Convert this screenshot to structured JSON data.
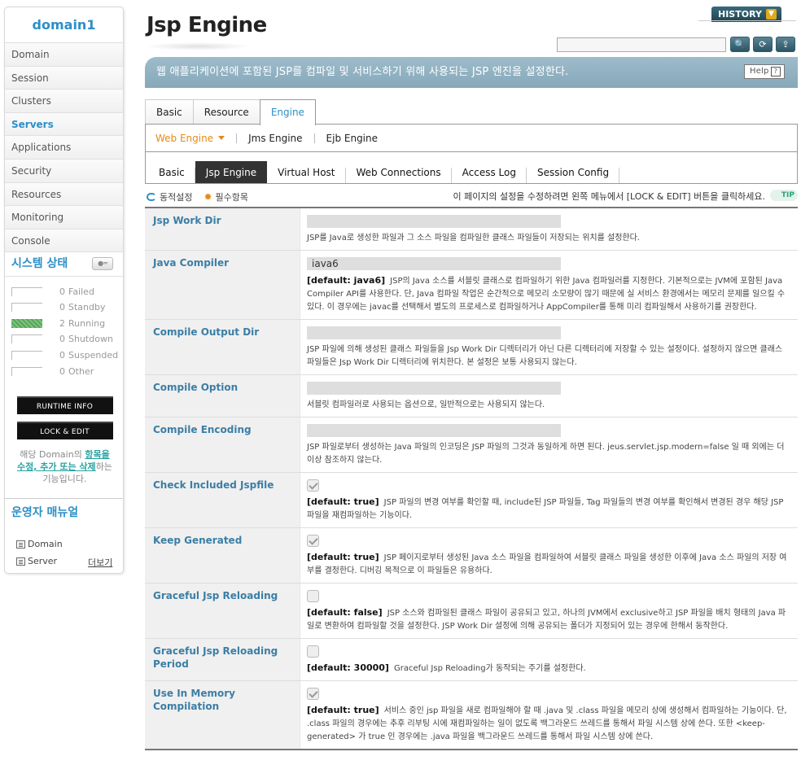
{
  "sidebar": {
    "domain_name": "domain1",
    "menu": [
      {
        "label": "Domain",
        "active": false
      },
      {
        "label": "Session",
        "active": false
      },
      {
        "label": "Clusters",
        "active": false
      },
      {
        "label": "Servers",
        "active": true
      },
      {
        "label": "Applications",
        "active": false
      },
      {
        "label": "Security",
        "active": false
      },
      {
        "label": "Resources",
        "active": false
      },
      {
        "label": "Monitoring",
        "active": false
      },
      {
        "label": "Console",
        "active": false
      }
    ],
    "status_title": "시스템 상태",
    "status": [
      {
        "count": "0",
        "label": "Failed"
      },
      {
        "count": "0",
        "label": "Standby"
      },
      {
        "count": "2",
        "label": "Running"
      },
      {
        "count": "0",
        "label": "Shutdown"
      },
      {
        "count": "0",
        "label": "Suspended"
      },
      {
        "count": "0",
        "label": "Other"
      }
    ],
    "runtime_info_label": "RUNTIME INFO",
    "lock_edit_label": "LOCK & EDIT",
    "lock_note_pre": "해당 Domain의 ",
    "lock_note_hl": "항목을 수정, 추가 또는 삭제",
    "lock_note_post": "하는 기능입니다.",
    "manual_title": "운영자 매뉴얼",
    "manual_items": [
      "Domain",
      "Server"
    ],
    "more_label": "더보기"
  },
  "header": {
    "title": "Jsp Engine",
    "history_label": "HISTORY",
    "search_value": "",
    "description": "웹 애플리케이션에 포함된 JSP를 컴파일 및 서비스하기 위해 사용되는 JSP 엔진을 설정한다.",
    "help_label": "Help"
  },
  "tabs": {
    "level1": [
      "Basic",
      "Resource",
      "Engine"
    ],
    "level1_active": 2,
    "level2": [
      "Web Engine",
      "Jms Engine",
      "Ejb Engine"
    ],
    "level3": [
      "Basic",
      "Jsp Engine",
      "Virtual Host",
      "Web Connections",
      "Access Log",
      "Session Config"
    ],
    "level3_active": 1
  },
  "notice": {
    "dynamic_label": "동적설정",
    "required_label": "필수항목",
    "text": "이 페이지의 설정을 수정하려면 왼쪽 메뉴에서 [LOCK & EDIT] 버튼을 클릭하세요.",
    "tip_label": "TIP"
  },
  "settings": [
    {
      "label": "Jsp Work Dir",
      "type": "text",
      "value": "",
      "default": "",
      "desc": "JSP를 Java로 생성한 파일과 그 소스 파일을 컴파일한 클래스 파일들이 저장되는 위치를 설정한다."
    },
    {
      "label": "Java Compiler",
      "type": "text",
      "value": "iava6",
      "default": "[default: java6]",
      "desc": "JSP의 Java 소스를 서블릿 클래스로 컴파일하기 위한 Java 컴파일러를 지정한다. 기본적으로는 JVM에 포함된 Java Compiler API를 사용한다. 단, Java 컴파일 작업은 순간적으로 메모리 소모량이 많기 때문에 실 서비스 환경에서는 메모리 문제를 일으킬 수 있다. 이 경우에는 javac를 선택해서 별도의 프로세스로 컴파일하거나 AppCompiler를 통해 미리 컴파일해서 사용하기를 권장한다."
    },
    {
      "label": "Compile Output Dir",
      "type": "text",
      "value": "",
      "default": "",
      "desc": "JSP 파일에 의해 생성된 클래스 파일들을 Jsp Work Dir 디렉터리가 아닌 다른 디렉터리에 저장할 수 있는 설정이다. 설정하지 않으면 클래스 파일들은 Jsp Work Dir 디렉터리에 위치한다. 본 설정은 보통 사용되지 않는다."
    },
    {
      "label": "Compile Option",
      "type": "text",
      "value": "",
      "default": "",
      "desc": "서블릿 컴파일러로 사용되는 옵션으로, 일반적으로는 사용되지 않는다."
    },
    {
      "label": "Compile Encoding",
      "type": "text",
      "value": "",
      "default": "",
      "desc": "JSP 파일로부터 생성하는 Java 파일의 인코딩은 JSP 파일의 그것과 동일하게 하면 된다. jeus.servlet.jsp.modern=false 일 때 외에는 더이상 참조하지 않는다."
    },
    {
      "label": "Check Included Jspfile",
      "type": "checkbox",
      "checked": true,
      "default": "[default: true]",
      "desc": "JSP 파일의 변경 여부를 확인할 때, include된 JSP 파일들, Tag 파일들의 변경 여부를 확인해서 변경된 경우 해당 JSP 파일을 재컴파일하는 기능이다."
    },
    {
      "label": "Keep Generated",
      "type": "checkbox",
      "checked": true,
      "default": "[default: true]",
      "desc": "JSP 페이지로부터 생성된 Java 소스 파일을 컴파일하여 서블릿 클래스 파일을 생성한 이후에 Java 소스 파일의 저장 여부를 결정한다. 디버깅 목적으로 이 파일들은 유용하다."
    },
    {
      "label": "Graceful Jsp Reloading",
      "type": "checkbox",
      "checked": false,
      "default": "[default: false]",
      "desc": "JSP 소스와 컴파일된 클래스 파일이 공유되고 있고, 하나의 JVM에서 exclusive하고 JSP 파일을 배치 형태의 Java 파일로 변환하여 컴파일할 것을 설정한다. JSP Work Dir 설정에 의해 공유되는 폴더가 지정되어 있는 경우에 한해서 동작한다."
    },
    {
      "label": "Graceful Jsp Reloading Period",
      "type": "checkbox",
      "checked": false,
      "default": "[default: 30000]",
      "desc": "Graceful Jsp Reloading가 동작되는 주기를 설정한다."
    },
    {
      "label": "Use In Memory Compilation",
      "type": "checkbox",
      "checked": true,
      "default": "[default: true]",
      "desc": "서비스 중인 jsp 파일을 새로 컴파일해야 할 때 .java 및 .class 파일을 메모리 상에 생성해서 컴파일하는 기능이다. 단, .class 파일의 경우에는 추후 리부팅 시에 재컴파일하는 일이 없도록 백그라운드 쓰레드를 통해서 파일 시스템 상에 쓴다. 또한 <keep-generated> 가 true 인 경우에는 .java 파일을 백그라운드 쓰레드를 통해서 파일 시스템 상에 쓴다."
    }
  ]
}
